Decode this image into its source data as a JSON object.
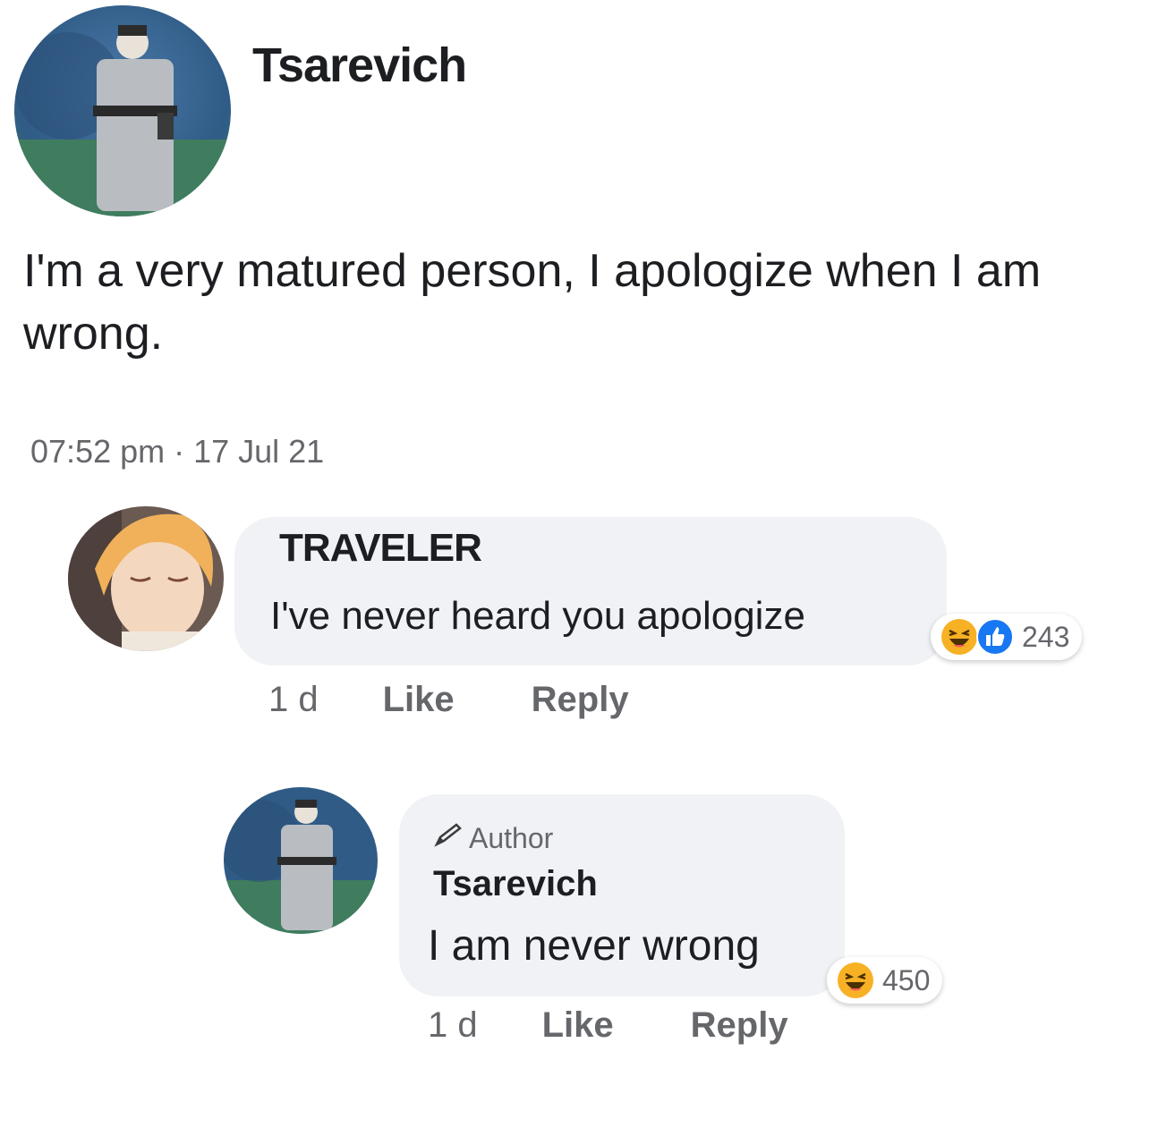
{
  "post": {
    "author": "Tsarevich",
    "text": "I'm a very matured person, I apologize when I am wrong.",
    "time": "07:52 pm · 17 Jul 21"
  },
  "comments": [
    {
      "name": "TRAVELER",
      "text": "I've never heard you apologize",
      "time": "1 d",
      "like_label": "Like",
      "reply_label": "Reply",
      "reactions": [
        "haha-icon",
        "like-icon"
      ],
      "reaction_count": "243"
    },
    {
      "badge": "Author",
      "name": "Tsarevich",
      "text": "I am never wrong",
      "time": "1 d",
      "like_label": "Like",
      "reply_label": "Reply",
      "reactions": [
        "haha-icon"
      ],
      "reaction_count": "450"
    }
  ],
  "colors": {
    "bubble": "#f0f2f5",
    "meta_text": "#65676b",
    "haha": "#f7b125",
    "like": "#1877f2"
  }
}
